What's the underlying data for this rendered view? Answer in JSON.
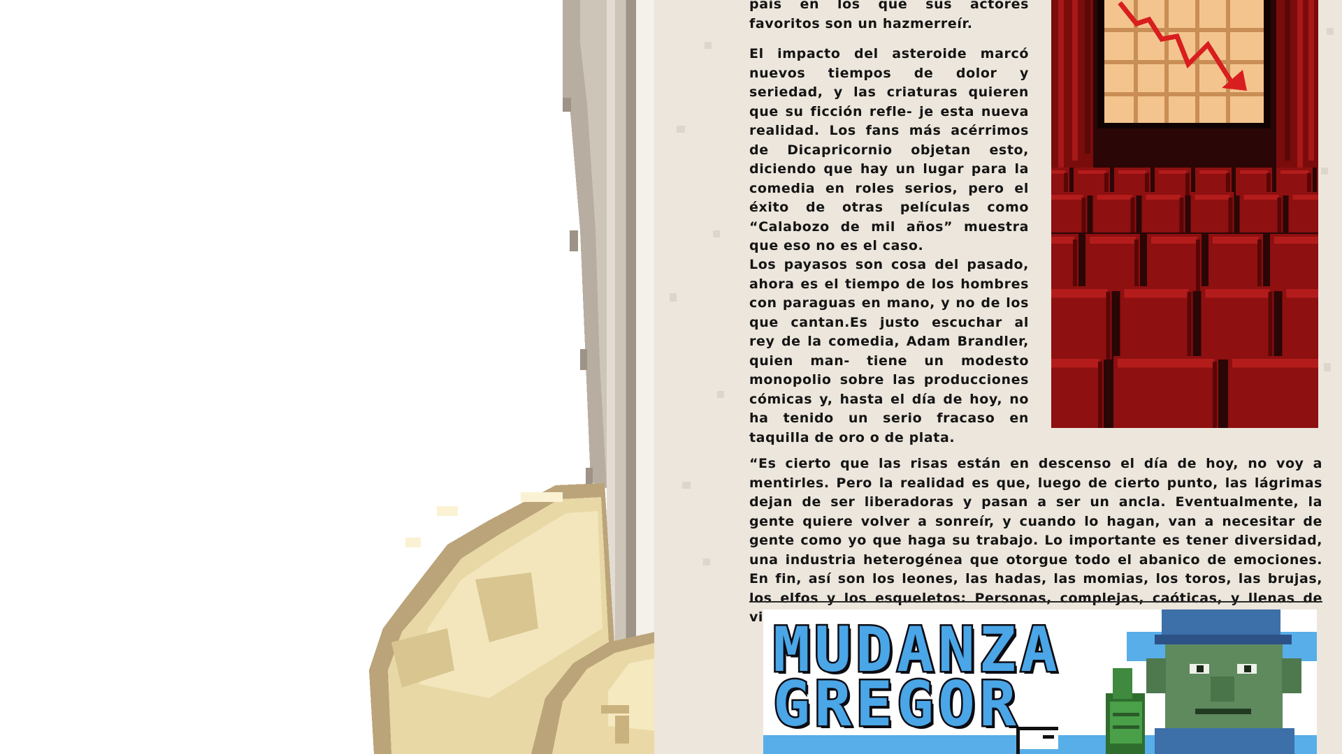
{
  "article": {
    "intro_text": "país en los que sus actores favoritos son un hazmerreír.",
    "paragraph_asteroid": "El impacto del asteroide marcó nuevos tiempos de dolor y seriedad, y las criaturas quieren que su ficción refle- je esta nueva realidad. Los fans más acérrimos de Dicapricornio objetan esto, diciendo que hay un lugar para la comedia en roles serios, pero el éxito de otras películas como “Calabozo de mil años” muestra que eso no es el caso.",
    "paragraph_payasos": "Los payasos son cosa del pasado, ahora es el tiempo de los hombres con paraguas en mano, y no de los que cantan.Es justo escuchar al rey de la comedia, Adam Brandler, quien man- tiene un modesto monopolio sobre las producciones cómicas y, hasta el día de hoy, no ha tenido un serio fracaso en taquilla de oro o de plata.",
    "quote": "“Es cierto que las risas están en descenso el día de hoy, no voy a mentirles. Pero la realidad es que, luego de cierto punto, las lágrimas dejan de ser liberadoras y pasan a ser un ancla. Eventualmente, la gente quiere volver a sonreír, y cuando lo hagan, van a necesitar de gente como yo que haga su trabajo. Lo importante es tener diversidad, una industria heterogénea que otorgue todo el abanico de emociones. En fin, así son los leones, las hadas, las momias, los toros, las brujas, los elfos y los esqueletos: Personas, complejas, caóticas, y llenas de vida.”"
  },
  "ad": {
    "line1": "MUDANZA",
    "line2": "GREGOR"
  },
  "colors": {
    "paper": "#ece6dc",
    "ink": "#141414",
    "theater_red": "#8e1010",
    "chart_arrow": "#d81e1e",
    "ad_blue": "#4aa6e6"
  }
}
